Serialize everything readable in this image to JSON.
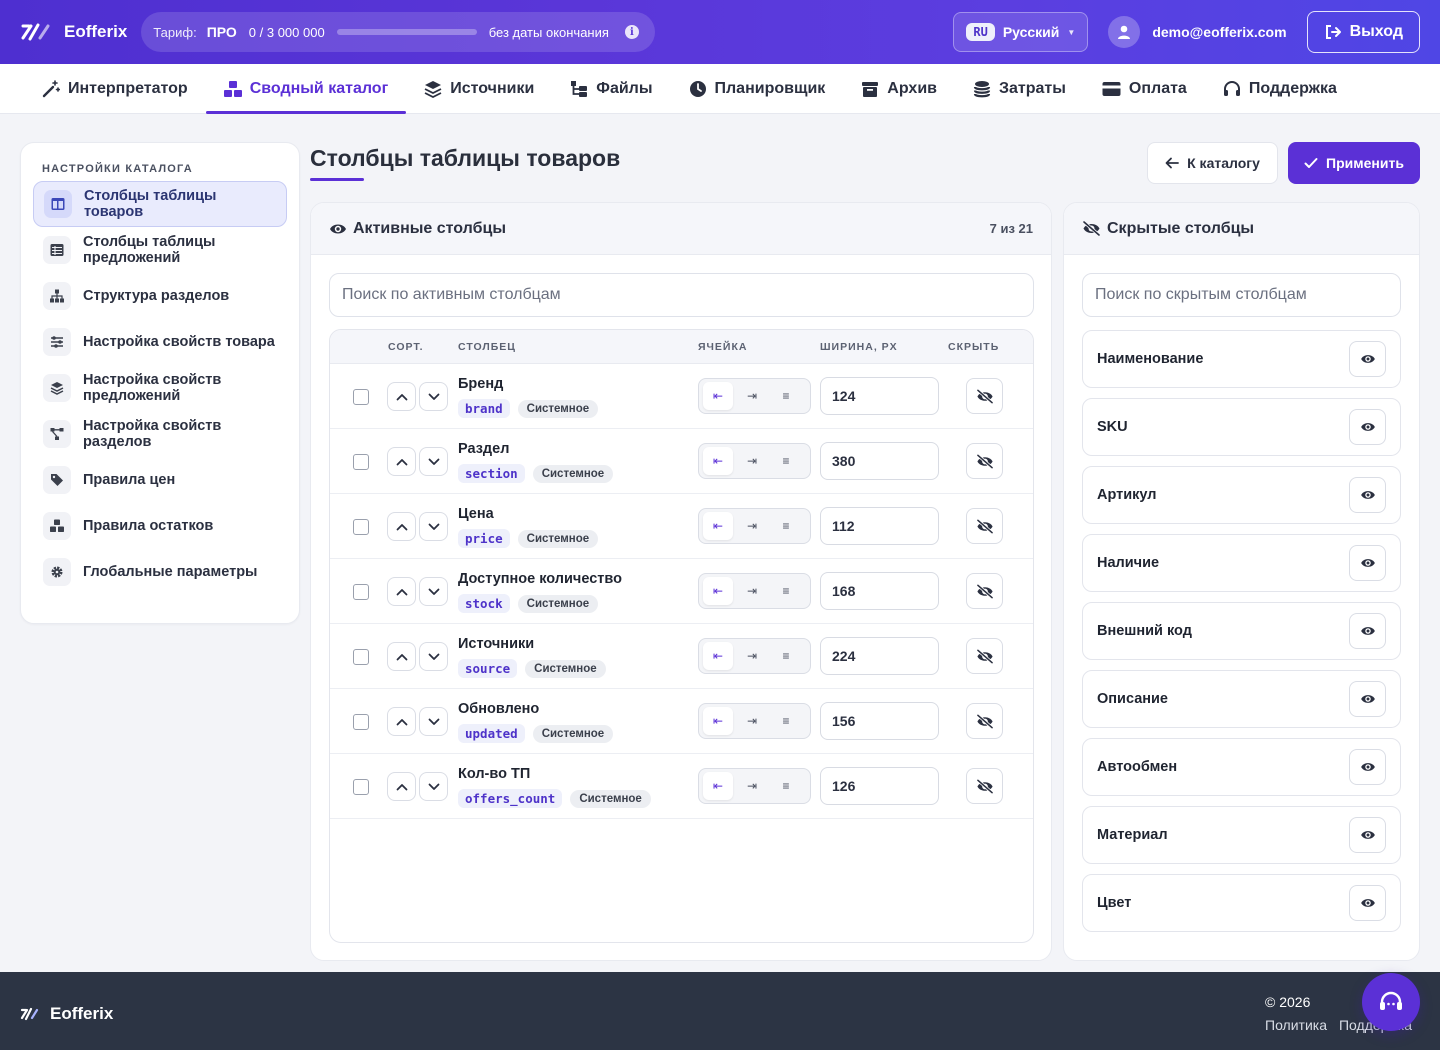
{
  "app": {
    "name": "Eofferix"
  },
  "tariff": {
    "label": "Тариф:",
    "plan": "ПРО",
    "usage": "0 / 3 000 000",
    "expiry": "без даты окончания",
    "usage_fraction": 0
  },
  "lang": {
    "code": "RU",
    "name": "Русский"
  },
  "user": {
    "email": "demo@eofferix.com"
  },
  "logout_label": "Выход",
  "nav": [
    {
      "label": "Интерпретатор",
      "icon": "magic-wand-icon"
    },
    {
      "label": "Сводный каталог",
      "icon": "boxes-icon",
      "active": true
    },
    {
      "label": "Источники",
      "icon": "layers-icon"
    },
    {
      "label": "Файлы",
      "icon": "folder-tree-icon"
    },
    {
      "label": "Планировщик",
      "icon": "clock-icon"
    },
    {
      "label": "Архив",
      "icon": "archive-icon"
    },
    {
      "label": "Затраты",
      "icon": "coins-icon"
    },
    {
      "label": "Оплата",
      "icon": "credit-card-icon"
    },
    {
      "label": "Поддержка",
      "icon": "headset-icon"
    }
  ],
  "sidebar": {
    "heading": "НАСТРОЙКИ КАТАЛОГА",
    "items": [
      {
        "label": "Столбцы таблицы товаров",
        "icon": "table-columns-icon",
        "active": true
      },
      {
        "label": "Столбцы таблицы предложений",
        "icon": "table-list-icon"
      },
      {
        "label": "Структура разделов",
        "icon": "sitemap-icon"
      },
      {
        "label": "Настройка свойств товара",
        "icon": "sliders-icon"
      },
      {
        "label": "Настройка свойств предложений",
        "icon": "layer-group-icon"
      },
      {
        "label": "Настройка свойств разделов",
        "icon": "diagram-icon"
      },
      {
        "label": "Правила цен",
        "icon": "tags-icon"
      },
      {
        "label": "Правила остатков",
        "icon": "cubes-icon"
      },
      {
        "label": "Глобальные параметры",
        "icon": "gear-icon"
      }
    ]
  },
  "page": {
    "title": "Столбцы таблицы товаров",
    "back_label": "К каталогу",
    "apply_label": "Применить"
  },
  "active": {
    "title": "Активные столбцы",
    "count": "7 из 21",
    "search_placeholder": "Поиск по активным столбцам",
    "headers": {
      "sort": "СОРТ.",
      "column": "СТОЛБЕЦ",
      "cell": "ЯЧЕЙКА",
      "width": "ШИРИНА, PX",
      "hide": "СКРЫТЬ"
    },
    "rows": [
      {
        "name": "Бренд",
        "code": "brand",
        "tag": "Системное",
        "width": "124",
        "align": "left"
      },
      {
        "name": "Раздел",
        "code": "section",
        "tag": "Системное",
        "width": "380",
        "align": "left"
      },
      {
        "name": "Цена",
        "code": "price",
        "tag": "Системное",
        "width": "112",
        "align": "left"
      },
      {
        "name": "Доступное количество",
        "code": "stock",
        "tag": "Системное",
        "width": "168",
        "align": "left"
      },
      {
        "name": "Источники",
        "code": "source",
        "tag": "Системное",
        "width": "224",
        "align": "left"
      },
      {
        "name": "Обновлено",
        "code": "updated",
        "tag": "Системное",
        "width": "156",
        "align": "left"
      },
      {
        "name": "Кол-во ТП",
        "code": "offers_count",
        "tag": "Системное",
        "width": "126",
        "align": "left"
      }
    ]
  },
  "hidden": {
    "title": "Скрытые столбцы",
    "search_placeholder": "Поиск по скрытым столбцам",
    "items": [
      "Наименование",
      "SKU",
      "Артикул",
      "Наличие",
      "Внешний код",
      "Описание",
      "Автообмен",
      "Материал",
      "Цвет"
    ]
  },
  "footer": {
    "copyright": "© 2026",
    "links": [
      "Политика",
      "Поддержка"
    ]
  },
  "colors": {
    "accent": "#5b30d6",
    "topbar_start": "#4e2fd0",
    "topbar_end": "#4f46e5",
    "footer": "#2c3444"
  }
}
